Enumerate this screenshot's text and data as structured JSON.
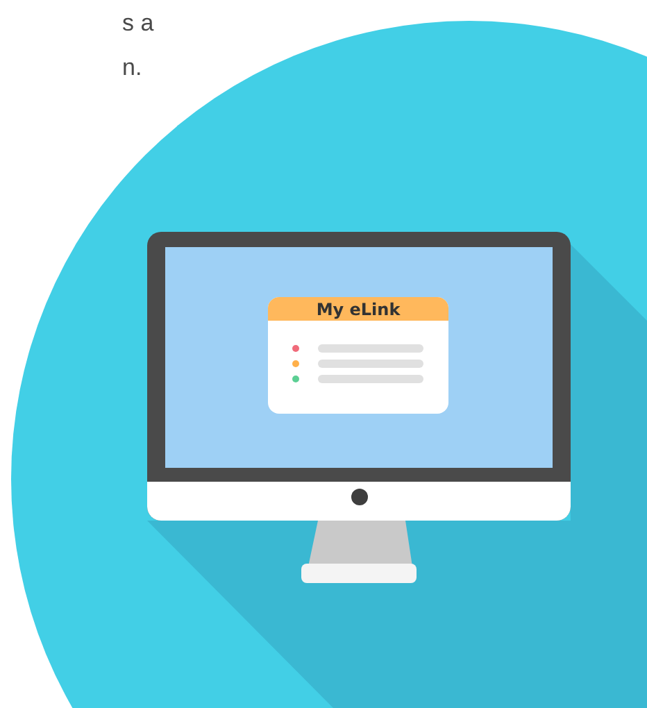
{
  "page_text": [
    "s a",
    "n."
  ],
  "app_window": {
    "title": "My eLink",
    "items": [
      {
        "color": "#f06b7a"
      },
      {
        "color": "#ffb04a"
      },
      {
        "color": "#5ccf94"
      }
    ]
  }
}
